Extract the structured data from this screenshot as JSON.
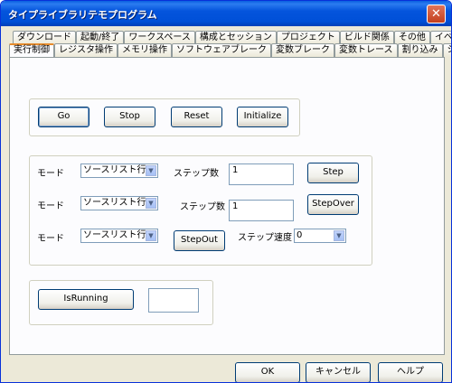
{
  "window": {
    "title": "タイプライブラリテモプログラム",
    "close_glyph": "✕"
  },
  "tabs": {
    "row1": [
      "ダウンロード",
      "起動/終了",
      "ワークスペース",
      "構成とセッション",
      "プロジェクト",
      "ビルド関係",
      "その他",
      "イベント"
    ],
    "row2": [
      "実行制御",
      "レジスタ操作",
      "メモリ操作",
      "ソフトウェアブレーク",
      "変数ブレーク",
      "変数トレース",
      "割り込み",
      "シンボル操作"
    ],
    "active": "実行制御"
  },
  "controls": {
    "go": "Go",
    "stop": "Stop",
    "reset": "Reset",
    "initialize": "Initialize"
  },
  "step": {
    "mode_label": "モード",
    "mode_value": "ソースリスト行",
    "step_count_label": "ステップ数",
    "step_count_value_1": "1",
    "step_count_value_2": "1",
    "step_button": "Step",
    "stepover_button": "StepOver",
    "stepout_button": "StepOut",
    "speed_label": "ステップ速度",
    "speed_value": "0",
    "dropdown_glyph": "▼"
  },
  "status": {
    "isrunning_button": "IsRunning",
    "isrunning_value": ""
  },
  "footer": {
    "ok": "OK",
    "cancel": "キャンセル",
    "help": "ヘルプ"
  }
}
